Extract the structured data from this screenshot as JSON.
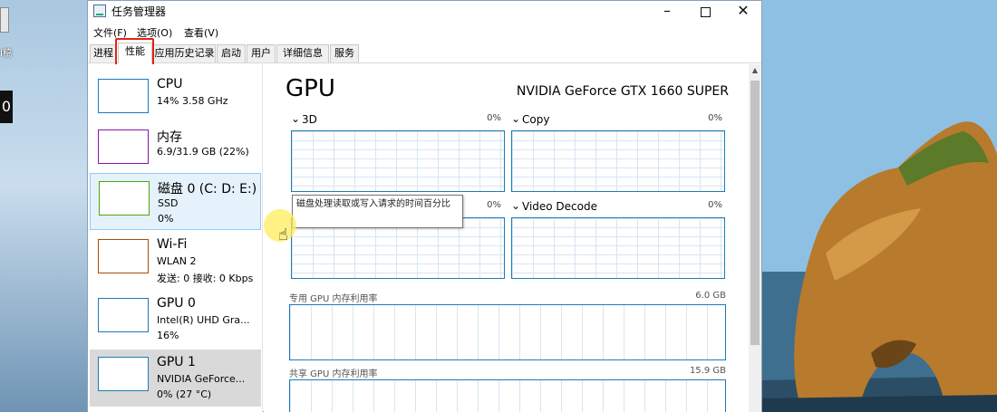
{
  "window": {
    "title": "任务管理器",
    "controls": {
      "minimize": "–",
      "maximize": "",
      "close": "✕"
    }
  },
  "menu": {
    "file": "文件(F)",
    "options": "选项(O)",
    "view": "查看(V)"
  },
  "tabs": [
    "进程",
    "性能",
    "应用历史记录",
    "启动",
    "用户",
    "详细信息",
    "服务"
  ],
  "active_tab": "性能",
  "desktop": {
    "label": "I稿",
    "fragment": "0"
  },
  "perf_items": [
    {
      "name": "CPU",
      "line2": "14% 3.58 GHz",
      "line3": "",
      "color": "#117dbb"
    },
    {
      "name": "内存",
      "line2": "6.9/31.9 GB (22%)",
      "line3": "",
      "color": "#8b12ae"
    },
    {
      "name": "磁盘 0 (C: D: E:)",
      "line2": "SSD",
      "line3": "0%",
      "color": "#4da60c"
    },
    {
      "name": "Wi-Fi",
      "line2": "WLAN 2",
      "line3": "发送: 0 接收: 0 Kbps",
      "color": "#a74f01"
    },
    {
      "name": "GPU 0",
      "line2": "Intel(R) UHD Gra...",
      "line3": "16%",
      "color": "#1e7bb6"
    },
    {
      "name": "GPU 1",
      "line2": "NVIDIA GeForce...",
      "line3": "0% (27 °C)",
      "color": "#1e7bb6"
    }
  ],
  "main": {
    "title": "GPU",
    "model": "NVIDIA GeForce GTX 1660 SUPER",
    "engines": [
      {
        "label": "3D",
        "pct": "0%"
      },
      {
        "label": "Copy",
        "pct": "0%"
      },
      {
        "label": "",
        "pct": "0%"
      },
      {
        "label": "Video Decode",
        "pct": "0%"
      }
    ],
    "dedicated_mem": {
      "label": "专用 GPU 内存利用率",
      "value": "6.0 GB"
    },
    "shared_mem": {
      "label": "共享 GPU 内存利用率",
      "value": "15.9 GB"
    }
  },
  "tooltip": "磁盘处理读取或写入请求的时间百分比"
}
